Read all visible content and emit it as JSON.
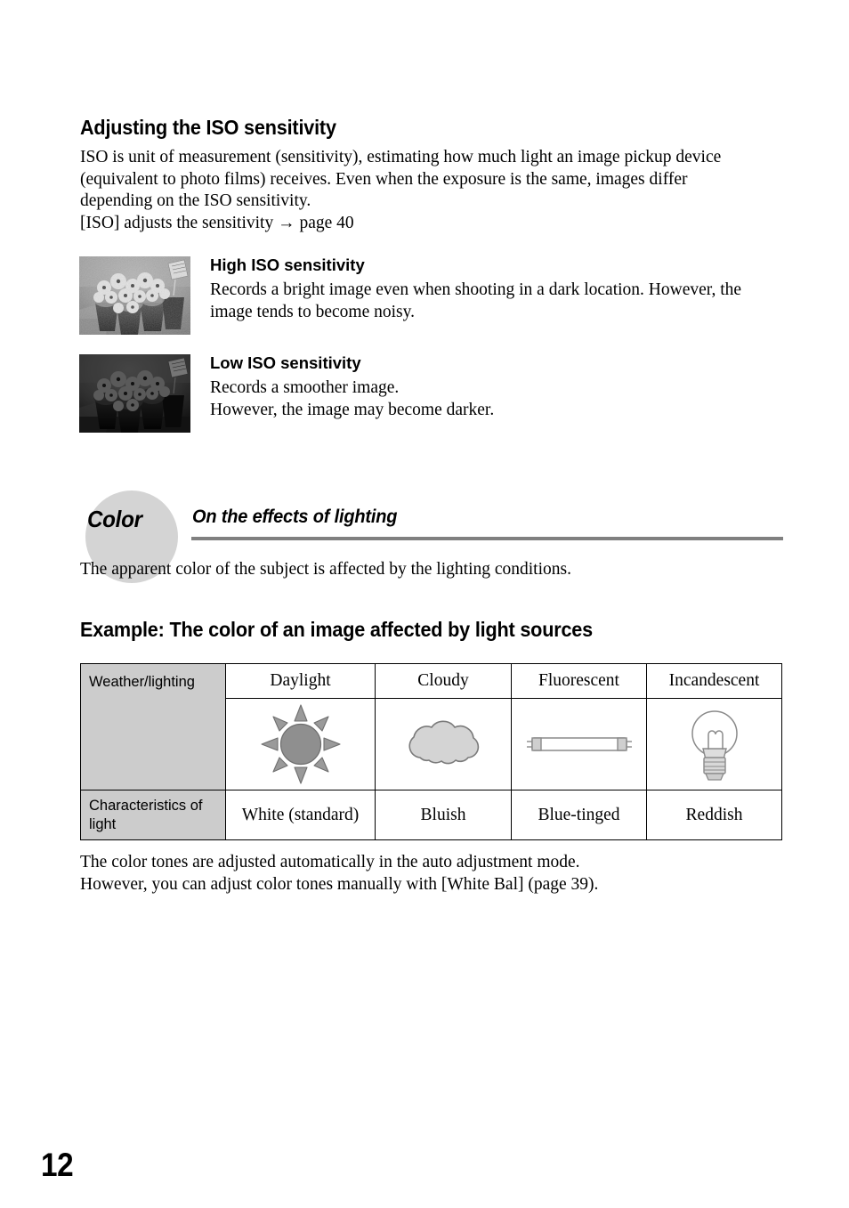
{
  "page": {
    "number": "12"
  },
  "iso_section": {
    "heading": "Adjusting the ISO sensitivity",
    "intro_lines": [
      "ISO is unit of measurement (sensitivity), estimating how much light an image pickup device",
      "(equivalent to photo films) receives. Even when the exposure is the same, images differ",
      "depending on the ISO sensitivity.",
      "[ISO] adjusts the sensitivity →  page 40"
    ],
    "examples": [
      {
        "image_alt": "Bright grayscale photo of potted flowers, noisy",
        "image_name": "high-iso-sample-photo",
        "title": "High ISO sensitivity",
        "desc_lines": [
          "Records a bright image even when shooting in a dark location. However, the",
          "image tends to become noisy."
        ]
      },
      {
        "image_alt": "Dark grayscale photo of potted flowers, smooth",
        "image_name": "low-iso-sample-photo",
        "title": "Low ISO sensitivity",
        "desc_lines": [
          "Records a smoother image.",
          "However, the image may become darker."
        ]
      }
    ]
  },
  "color_section": {
    "badge_label": "Color",
    "subtitle": "On the effects of lighting",
    "intro_lines": [
      "The apparent color of the subject is affected by the lighting conditions."
    ],
    "example_heading": "Example: The color of an image affected by light sources",
    "outro_lines": [
      "The color tones are adjusted automatically in the auto adjustment mode.",
      "However, you can adjust color tones manually with [White Bal] (page 39)."
    ],
    "table": {
      "row_labels": [
        "Weather/lighting",
        "Characteristics of light"
      ],
      "columns": [
        {
          "header": "Daylight",
          "icon": "sun-icon",
          "characteristic": "White (standard)"
        },
        {
          "header": "Cloudy",
          "icon": "cloud-icon",
          "characteristic": "Bluish"
        },
        {
          "header": "Fluorescent",
          "icon": "fluorescent-tube-icon",
          "characteristic": "Blue-tinged"
        },
        {
          "header": "Incandescent",
          "icon": "light-bulb-icon",
          "characteristic": "Reddish"
        }
      ]
    },
    "colors": {
      "badge_fill": "#d4d4d4",
      "rule": "#808080",
      "table_label_fill": "#cccccc",
      "icon_gray": "#8c8c8c",
      "icon_light_gray": "#d4d4d4"
    }
  }
}
